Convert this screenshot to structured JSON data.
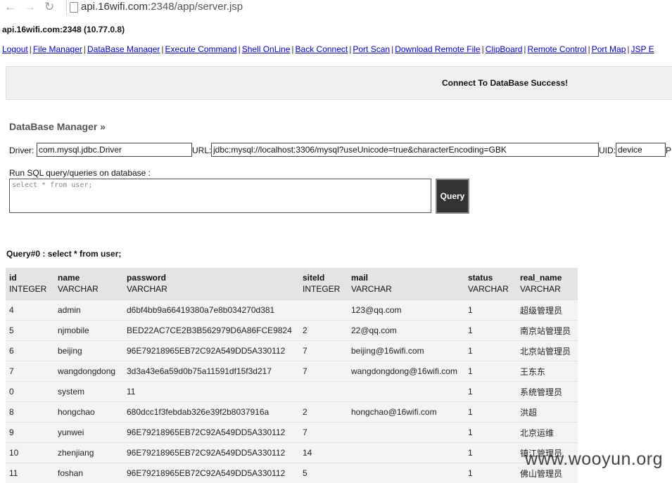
{
  "browser": {
    "url_host": "api.16wifi.com",
    "url_rest": ":2348/app/server.jsp"
  },
  "host_info": "api.16wifi.com:2348 (10.77.0.8)",
  "menu": [
    "Logout",
    "File Manager",
    "DataBase Manager",
    "Execute Command",
    "Shell OnLine",
    "Back Connect",
    "Port Scan",
    "Download Remote File",
    "ClipBoard",
    "Remote Control",
    "Port Map",
    "JSP E"
  ],
  "banner": "Connect To DataBase Success!",
  "section_title": "DataBase Manager »",
  "connection": {
    "driver_label": "Driver:",
    "driver_value": "com.mysql.jdbc.Driver",
    "url_label": "URL:",
    "url_value": "jdbc:mysql://localhost:3306/mysql?useUnicode=true&characterEncoding=GBK",
    "uid_label": "UID:",
    "uid_value": "device",
    "pwd_label": "P"
  },
  "sql": {
    "label": "Run SQL query/queries on database :",
    "value": "select * from user;",
    "button": "Query"
  },
  "query_title": "Query#0 : select * from user;",
  "table": {
    "columns": [
      {
        "name": "id",
        "type": "INTEGER"
      },
      {
        "name": "name",
        "type": "VARCHAR"
      },
      {
        "name": "password",
        "type": "VARCHAR"
      },
      {
        "name": "siteId",
        "type": "INTEGER"
      },
      {
        "name": "mail",
        "type": "VARCHAR"
      },
      {
        "name": "status",
        "type": "VARCHAR"
      },
      {
        "name": "real_name",
        "type": "VARCHAR"
      }
    ],
    "rows": [
      [
        "4",
        "admin",
        "d6bf4bb9a66419380a7e8b034270d381",
        "",
        "123@qq.com",
        "1",
        "超级管理员"
      ],
      [
        "5",
        "njmobile",
        "BED22AC7CE2B3B562979D6A86FCE9824",
        "2",
        "22@qq.com",
        "1",
        "南京站管理员"
      ],
      [
        "6",
        "beijing",
        "96E79218965EB72C92A549DD5A330112",
        "7",
        "beijing@16wifi.com",
        "1",
        "北京站管理员"
      ],
      [
        "7",
        "wangdongdong",
        "3d3a43e6a59d0b75a11591df15f3d217",
        "7",
        "wangdongdong@16wifi.com",
        "1",
        "王东东"
      ],
      [
        "0",
        "system",
        "11",
        "",
        "",
        "1",
        "系统管理员"
      ],
      [
        "8",
        "hongchao",
        "680dcc1f3febdab326e39f2b8037916a",
        "2",
        "hongchao@16wifi.com",
        "1",
        "洪超"
      ],
      [
        "9",
        "yunwei",
        "96E79218965EB72C92A549DD5A330112",
        "7",
        "",
        "1",
        "北京运维"
      ],
      [
        "10",
        "zhenjiang",
        "96E79218965EB72C92A549DD5A330112",
        "14",
        "",
        "1",
        "镇江管理员"
      ],
      [
        "11",
        "foshan",
        "96E79218965EB72C92A549DD5A330112",
        "5",
        "",
        "1",
        "佛山管理员"
      ]
    ]
  },
  "watermark": "www.wooyun.org"
}
